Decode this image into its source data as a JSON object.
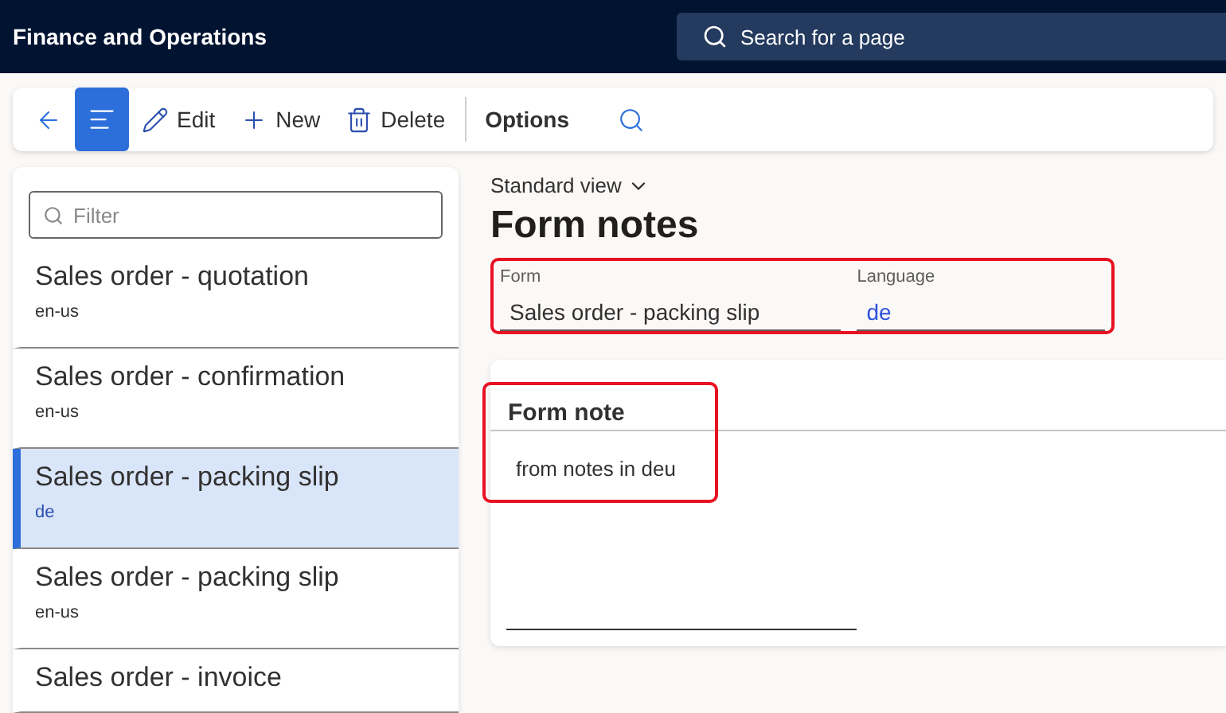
{
  "app_bar": {
    "title": "Finance and Operations",
    "search_placeholder": "Search for a page"
  },
  "toolbar": {
    "items": [
      {
        "kind": "back",
        "selected": false
      },
      {
        "kind": "menu",
        "selected": true
      },
      {
        "kind": "edit",
        "label": "Edit",
        "selected": false
      },
      {
        "kind": "new",
        "label": "New",
        "selected": false
      },
      {
        "kind": "delete",
        "label": "Delete",
        "selected": false
      },
      {
        "kind": "options",
        "label": "Options",
        "selected": false
      },
      {
        "kind": "search",
        "selected": false
      }
    ]
  },
  "list": {
    "filter_placeholder": "Filter",
    "items": [
      {
        "title": "Sales order - quotation",
        "subtitle": "en-us",
        "selected": false
      },
      {
        "title": "Sales order - confirmation",
        "subtitle": "en-us",
        "selected": false
      },
      {
        "title": "Sales order - packing slip",
        "subtitle": "de",
        "selected": true
      },
      {
        "title": "Sales order - packing slip",
        "subtitle": "en-us",
        "selected": false
      },
      {
        "title": "Sales order - invoice",
        "selected": false
      }
    ]
  },
  "view": {
    "label": "Standard view"
  },
  "page_title": "Form notes",
  "fields": [
    {
      "label": "Form",
      "value": "Sales order - packing slip",
      "kind": "text"
    },
    {
      "label": "Language",
      "value": "de",
      "kind": "link"
    }
  ],
  "note_card": {
    "title": "Form note",
    "text": "from notes in deu"
  }
}
